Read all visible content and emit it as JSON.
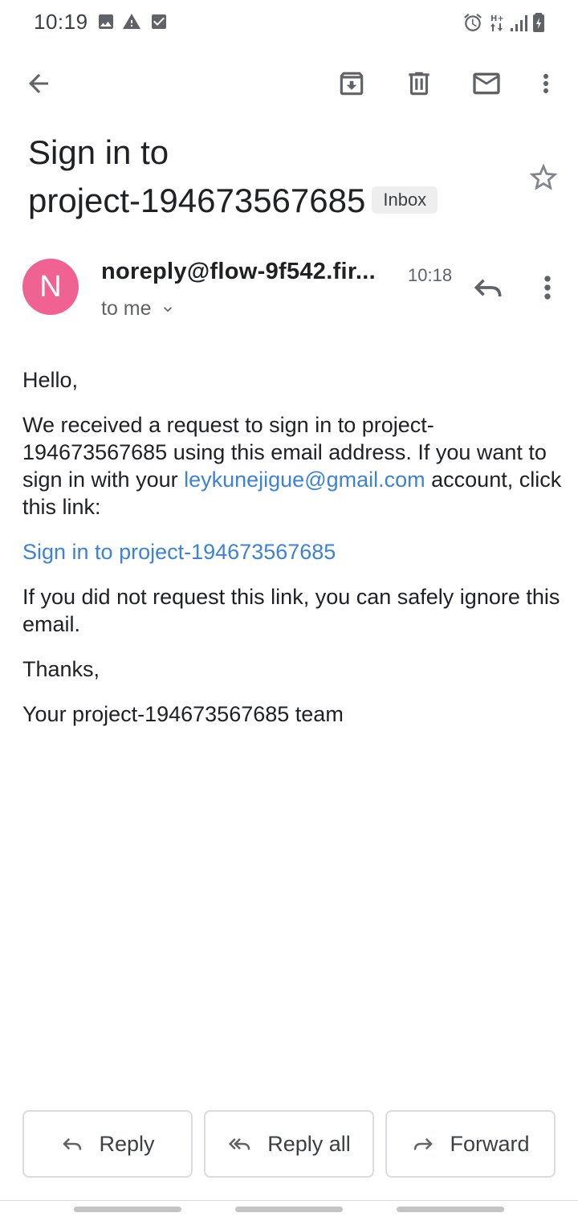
{
  "status_bar": {
    "time": "10:19",
    "left_icons": [
      "image-icon",
      "warning-icon",
      "checkbox-icon"
    ],
    "right_icons": [
      "alarm-icon",
      "data-icon",
      "signal-icon",
      "battery-icon"
    ]
  },
  "toolbar": {
    "back_icon": "arrow-left-icon",
    "archive_icon": "archive-icon",
    "delete_icon": "trash-icon",
    "mark_unread_icon": "mail-icon",
    "more_icon": "more-vert-icon"
  },
  "email": {
    "subject_line1": "Sign in to",
    "subject_line2": "project-194673567685",
    "label_chip": "Inbox",
    "sender": {
      "avatar_letter": "N",
      "avatar_color": "#f06292",
      "name": "noreply@flow-9f542.fir...",
      "time": "10:18",
      "recipient": "to me"
    },
    "body": {
      "greeting": "Hello,",
      "para1_before_email": "We received a request to sign in to project-194673567685 using this email address. If you want to sign in with your ",
      "para1_email": "leykunejigue@gmail.com",
      "para1_after_email": " account, click this link:",
      "sign_in_link": "Sign in to project-194673567685",
      "para2": "If you did not request this link, you can safely ignore this email.",
      "thanks": "Thanks,",
      "signature": "Your project-194673567685 team"
    }
  },
  "actions": {
    "reply": "Reply",
    "reply_all": "Reply all",
    "forward": "Forward"
  },
  "colors": {
    "link": "#3c82d7",
    "icon": "#5f6368"
  }
}
